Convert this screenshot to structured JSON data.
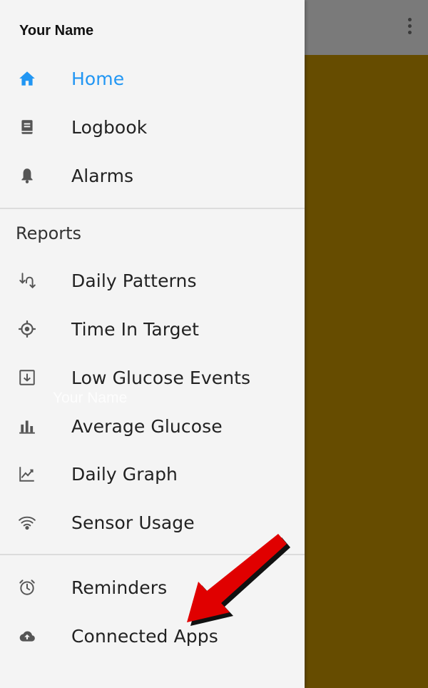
{
  "user": {
    "name": "Your Name"
  },
  "colors": {
    "accent": "#2196f3",
    "backdrop": "#664c00",
    "topbar": "#7a7a7a",
    "drawer_bg": "#f4f4f4",
    "icon_gray": "#555555",
    "arrow_red": "#e00000"
  },
  "nav": {
    "main": [
      {
        "label": "Home",
        "icon": "home-icon",
        "active": true
      },
      {
        "label": "Logbook",
        "icon": "book-icon",
        "active": false
      },
      {
        "label": "Alarms",
        "icon": "bell-icon",
        "active": false
      }
    ],
    "reports_title": "Reports",
    "reports": [
      {
        "label": "Daily Patterns",
        "icon": "daily-patterns-icon"
      },
      {
        "label": "Time In Target",
        "icon": "crosshair-icon"
      },
      {
        "label": "Low Glucose Events",
        "icon": "download-box-icon"
      },
      {
        "label": "Average Glucose",
        "icon": "bar-chart-icon"
      },
      {
        "label": "Daily Graph",
        "icon": "line-chart-icon"
      },
      {
        "label": "Sensor Usage",
        "icon": "wifi-icon"
      }
    ],
    "other": [
      {
        "label": "Reminders",
        "icon": "alarm-clock-icon"
      },
      {
        "label": "Connected Apps",
        "icon": "cloud-upload-icon"
      }
    ]
  },
  "watermark": "Your Name"
}
